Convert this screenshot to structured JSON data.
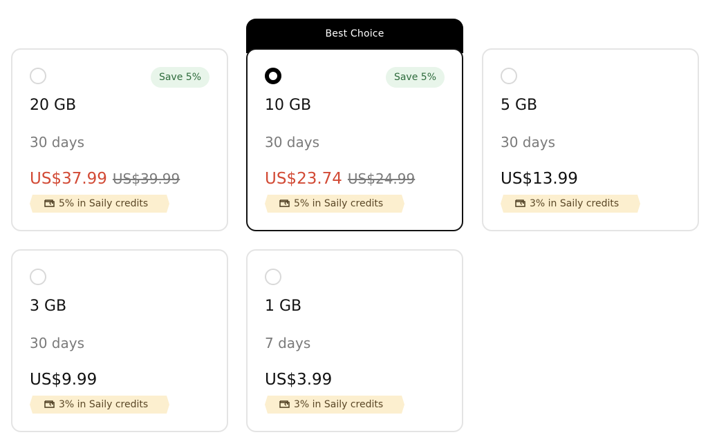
{
  "best_choice_label": "Best Choice",
  "plans": [
    {
      "data": "20 GB",
      "duration": "30 days",
      "price": "US$37.99",
      "old_price": "US$39.99",
      "save": "Save 5%",
      "credits": "5% in Saily credits",
      "selected": false
    },
    {
      "data": "10 GB",
      "duration": "30 days",
      "price": "US$23.74",
      "old_price": "US$24.99",
      "save": "Save 5%",
      "credits": "5% in Saily credits",
      "selected": true
    },
    {
      "data": "5 GB",
      "duration": "30 days",
      "price": "US$13.99",
      "credits": "3% in Saily credits",
      "selected": false
    },
    {
      "data": "3 GB",
      "duration": "30 days",
      "price": "US$9.99",
      "credits": "3% in Saily credits",
      "selected": false
    },
    {
      "data": "1 GB",
      "duration": "7 days",
      "price": "US$3.99",
      "credits": "3% in Saily credits",
      "selected": false
    }
  ],
  "colors": {
    "discount_price": "#d24a35",
    "save_badge_bg": "#e8f5ea",
    "save_badge_text": "#2e6b3c",
    "credits_bg": "#fcefcf",
    "selected_border": "#111111"
  },
  "icons": {
    "credits": "wallet-icon"
  }
}
